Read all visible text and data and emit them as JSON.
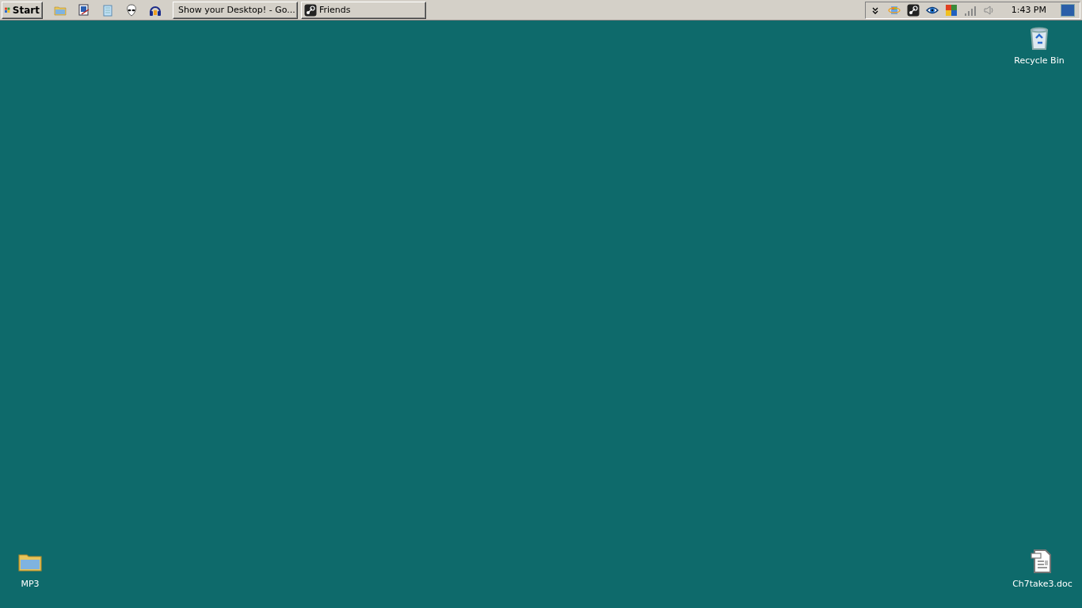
{
  "taskbar": {
    "start_button": {
      "label": "Start"
    },
    "quick_launch": [
      {
        "kind": "folder"
      },
      {
        "kind": "monitor"
      },
      {
        "kind": "notepad"
      },
      {
        "kind": "alien"
      },
      {
        "kind": "headphones"
      }
    ],
    "tasks": [
      {
        "kind": "browser",
        "label": "Show your Desktop! - Go..."
      },
      {
        "kind": "steam",
        "label": "Friends"
      }
    ],
    "tray": {
      "icons": [
        {
          "kind": "chevron"
        },
        {
          "kind": "orbit"
        },
        {
          "kind": "steam"
        },
        {
          "kind": "eye"
        },
        {
          "kind": "tiles"
        },
        {
          "kind": "signal"
        },
        {
          "kind": "speaker"
        }
      ],
      "clock": "1:43 PM"
    }
  },
  "desktop": {
    "top_icons": [
      {
        "kind": "recycle-bin",
        "label": "Recycle Bin"
      }
    ],
    "bottom_icons": [
      {
        "kind": "folder",
        "label": "MP3"
      },
      {
        "kind": "document",
        "label": "Ch7take3.doc"
      }
    ]
  }
}
